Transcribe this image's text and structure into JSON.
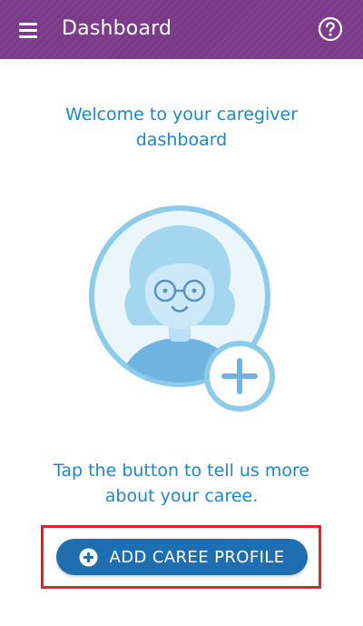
{
  "app_bar": {
    "title": "Dashboard",
    "menu_icon": "hamburger-menu-icon",
    "help_icon": "help-question-icon",
    "background_color": "#7b3a88"
  },
  "main": {
    "welcome_text": "Welcome to your caregiver dashboard",
    "illustration": {
      "icon": "caree-avatar-add-icon"
    },
    "instruction_text": "Tap the button to tell us more about your caree.",
    "accent_color": "#1f86c4"
  },
  "cta": {
    "label": "ADD CAREE PROFILE",
    "icon": "plus-circle-icon",
    "color": "#1f6fb0",
    "highlight_color": "#e3202d"
  }
}
